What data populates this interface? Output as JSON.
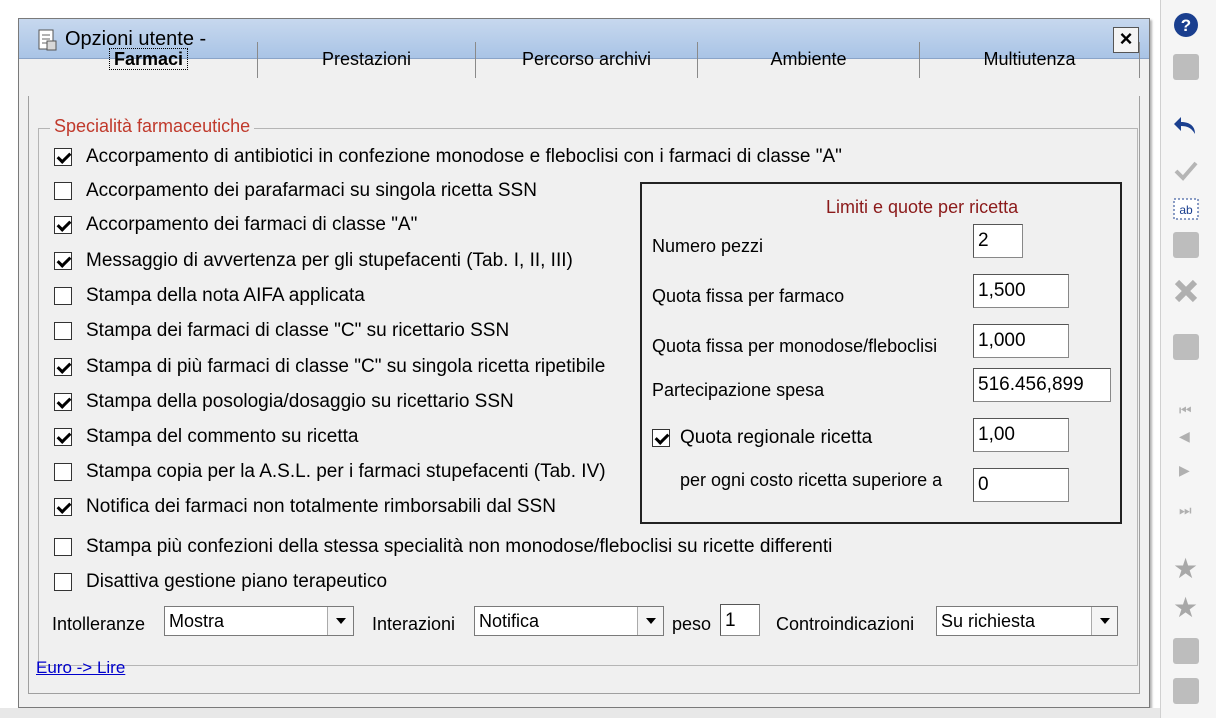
{
  "window": {
    "title": "Opzioni utente -",
    "close_label": "×"
  },
  "tabs": [
    {
      "label": "Farmaci",
      "active": true
    },
    {
      "label": "Prestazioni",
      "active": false
    },
    {
      "label": "Percorso archivi",
      "active": false
    },
    {
      "label": "Ambiente",
      "active": false
    },
    {
      "label": "Multiutenza",
      "active": false
    }
  ],
  "group": {
    "title": "Specialità farmaceutiche"
  },
  "checks": [
    {
      "label": "Accorpamento di antibiotici in confezione monodose e fleboclisi con i farmaci di classe \"A\"",
      "checked": true
    },
    {
      "label": "Accorpamento dei parafarmaci su singola ricetta SSN",
      "checked": false
    },
    {
      "label": "Accorpamento dei farmaci di classe \"A\"",
      "checked": true
    },
    {
      "label": "Messaggio di avvertenza per gli stupefacenti (Tab. I, II, III)",
      "checked": true
    },
    {
      "label": "Stampa della nota AIFA applicata",
      "checked": false
    },
    {
      "label": "Stampa dei farmaci di classe \"C\" su ricettario SSN",
      "checked": false
    },
    {
      "label": "Stampa di più farmaci di classe \"C\" su singola ricetta ripetibile",
      "checked": true
    },
    {
      "label": "Stampa della posologia/dosaggio su ricettario SSN",
      "checked": true
    },
    {
      "label": "Stampa del commento su ricetta",
      "checked": true
    },
    {
      "label": "Stampa copia per la A.S.L. per i farmaci stupefacenti (Tab. IV)",
      "checked": false
    },
    {
      "label": "Notifica dei farmaci non totalmente rimborsabili dal SSN",
      "checked": true
    },
    {
      "label": "Stampa più confezioni della stessa specialità non monodose/fleboclisi su ricette differenti",
      "checked": false
    },
    {
      "label": "Disattiva gestione piano terapeutico",
      "checked": false
    }
  ],
  "limits": {
    "title": "Limiti e quote per ricetta",
    "numero_pezzi_label": "Numero pezzi",
    "numero_pezzi_value": "2",
    "quota_fissa_label": "Quota fissa per farmaco",
    "quota_fissa_value": "1,500",
    "quota_mono_label": "Quota fissa per monodose/fleboclisi",
    "quota_mono_value": "1,000",
    "partecipazione_label": "Partecipazione spesa",
    "partecipazione_value": "516.456,899",
    "quota_regionale_label": "Quota regionale ricetta",
    "quota_regionale_checked": true,
    "quota_regionale_value": "1,00",
    "costo_label": "per ogni costo ricetta superiore a",
    "costo_value": "0"
  },
  "bottom": {
    "intolleranze_label": "Intolleranze",
    "intolleranze_value": "Mostra",
    "interazioni_label": "Interazioni",
    "interazioni_value": "Notifica",
    "peso_label": "peso",
    "peso_value": "1",
    "controindicazioni_label": "Controindicazioni",
    "controindicazioni_value": "Su richiesta"
  },
  "link": {
    "label": "Euro -> Lire"
  },
  "sidebar": {
    "icons": [
      "help-icon",
      "page-icon",
      "undo-icon",
      "check-icon",
      "ab-icon",
      "copy-icon",
      "delete-icon",
      "grid-icon",
      "first-icon",
      "prev-icon",
      "next-icon",
      "last-icon",
      "star-icon",
      "star-multi-icon",
      "print-icon",
      "list-icon"
    ]
  }
}
